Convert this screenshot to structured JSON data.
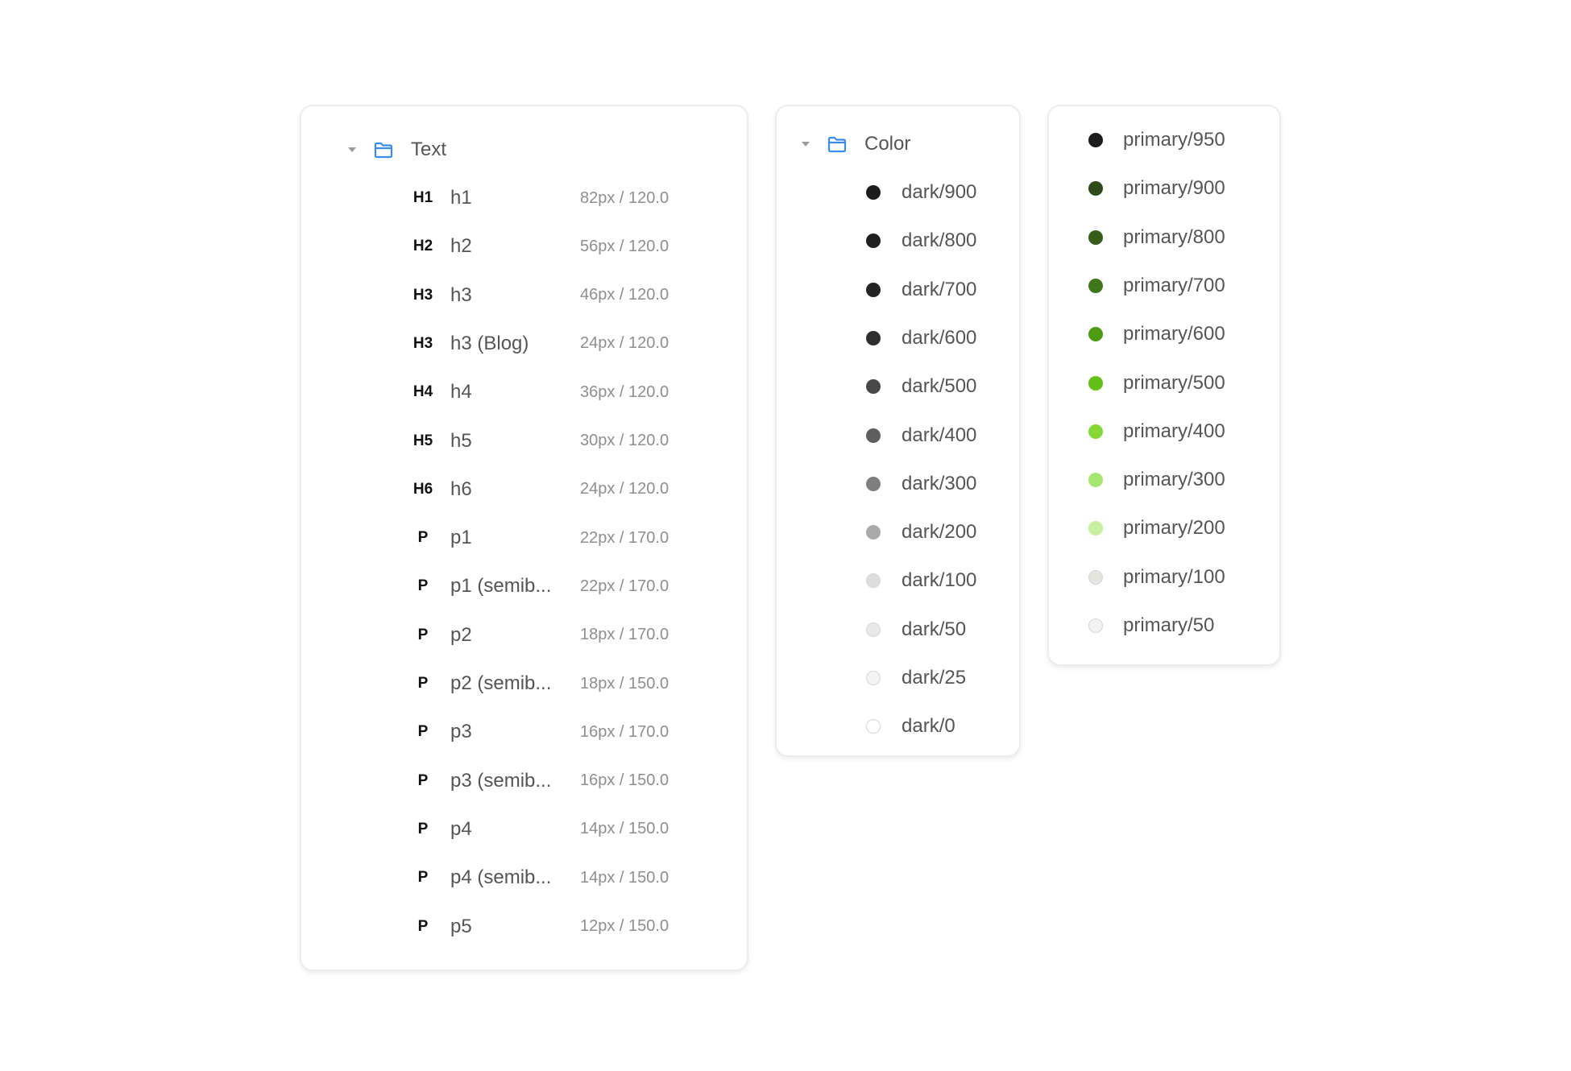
{
  "text_panel": {
    "folder_label": "Text",
    "icons": {
      "caret": "caret-down-icon",
      "folder": "folder-icon"
    },
    "styles": [
      {
        "tag": "H1",
        "name": "h1",
        "meta": "82px / 120.0"
      },
      {
        "tag": "H2",
        "name": "h2",
        "meta": "56px / 120.0"
      },
      {
        "tag": "H3",
        "name": "h3",
        "meta": "46px / 120.0"
      },
      {
        "tag": "H3",
        "name": "h3 (Blog)",
        "meta": "24px / 120.0"
      },
      {
        "tag": "H4",
        "name": "h4",
        "meta": "36px / 120.0"
      },
      {
        "tag": "H5",
        "name": "h5",
        "meta": "30px / 120.0"
      },
      {
        "tag": "H6",
        "name": "h6",
        "meta": "24px / 120.0"
      },
      {
        "tag": "P",
        "name": "p1",
        "meta": "22px / 170.0"
      },
      {
        "tag": "P",
        "name": "p1 (semib...",
        "meta": "22px / 170.0"
      },
      {
        "tag": "P",
        "name": "p2",
        "meta": "18px / 170.0"
      },
      {
        "tag": "P",
        "name": "p2 (semib...",
        "meta": "18px / 150.0"
      },
      {
        "tag": "P",
        "name": "p3",
        "meta": "16px / 170.0"
      },
      {
        "tag": "P",
        "name": "p3 (semib...",
        "meta": "16px / 150.0"
      },
      {
        "tag": "P",
        "name": "p4",
        "meta": "14px / 150.0"
      },
      {
        "tag": "P",
        "name": "p4 (semib...",
        "meta": "14px / 150.0"
      },
      {
        "tag": "P",
        "name": "p5",
        "meta": "12px / 150.0"
      }
    ]
  },
  "color_panel": {
    "folder_label": "Color",
    "icons": {
      "caret": "caret-down-icon",
      "folder": "folder-icon"
    },
    "colors": [
      {
        "name": "dark/900",
        "hex": "#1c1c1c"
      },
      {
        "name": "dark/800",
        "hex": "#202020"
      },
      {
        "name": "dark/700",
        "hex": "#242424"
      },
      {
        "name": "dark/600",
        "hex": "#2e2e2e"
      },
      {
        "name": "dark/500",
        "hex": "#484848"
      },
      {
        "name": "dark/400",
        "hex": "#5e5e5e"
      },
      {
        "name": "dark/300",
        "hex": "#7f7f7f"
      },
      {
        "name": "dark/200",
        "hex": "#aaaaaa"
      },
      {
        "name": "dark/100",
        "hex": "#dddddd"
      },
      {
        "name": "dark/50",
        "hex": "#e8e8e8"
      },
      {
        "name": "dark/25",
        "hex": "#f4f4f4"
      },
      {
        "name": "dark/0",
        "hex": "#ffffff"
      }
    ]
  },
  "primary_panel": {
    "colors": [
      {
        "name": "primary/950",
        "hex": "#1a1d19"
      },
      {
        "name": "primary/900",
        "hex": "#2f4a1a"
      },
      {
        "name": "primary/800",
        "hex": "#365c1c"
      },
      {
        "name": "primary/700",
        "hex": "#3f7619"
      },
      {
        "name": "primary/600",
        "hex": "#4f9a14"
      },
      {
        "name": "primary/500",
        "hex": "#64bf16"
      },
      {
        "name": "primary/400",
        "hex": "#86d935"
      },
      {
        "name": "primary/300",
        "hex": "#a7e670"
      },
      {
        "name": "primary/200",
        "hex": "#c8f0a1"
      },
      {
        "name": "primary/100",
        "hex": "#e2e6de"
      },
      {
        "name": "primary/50",
        "hex": "#f2f2f2"
      }
    ]
  },
  "accent": {
    "folder_blue": "#3b8cf0",
    "panel_border": "#ececec"
  }
}
